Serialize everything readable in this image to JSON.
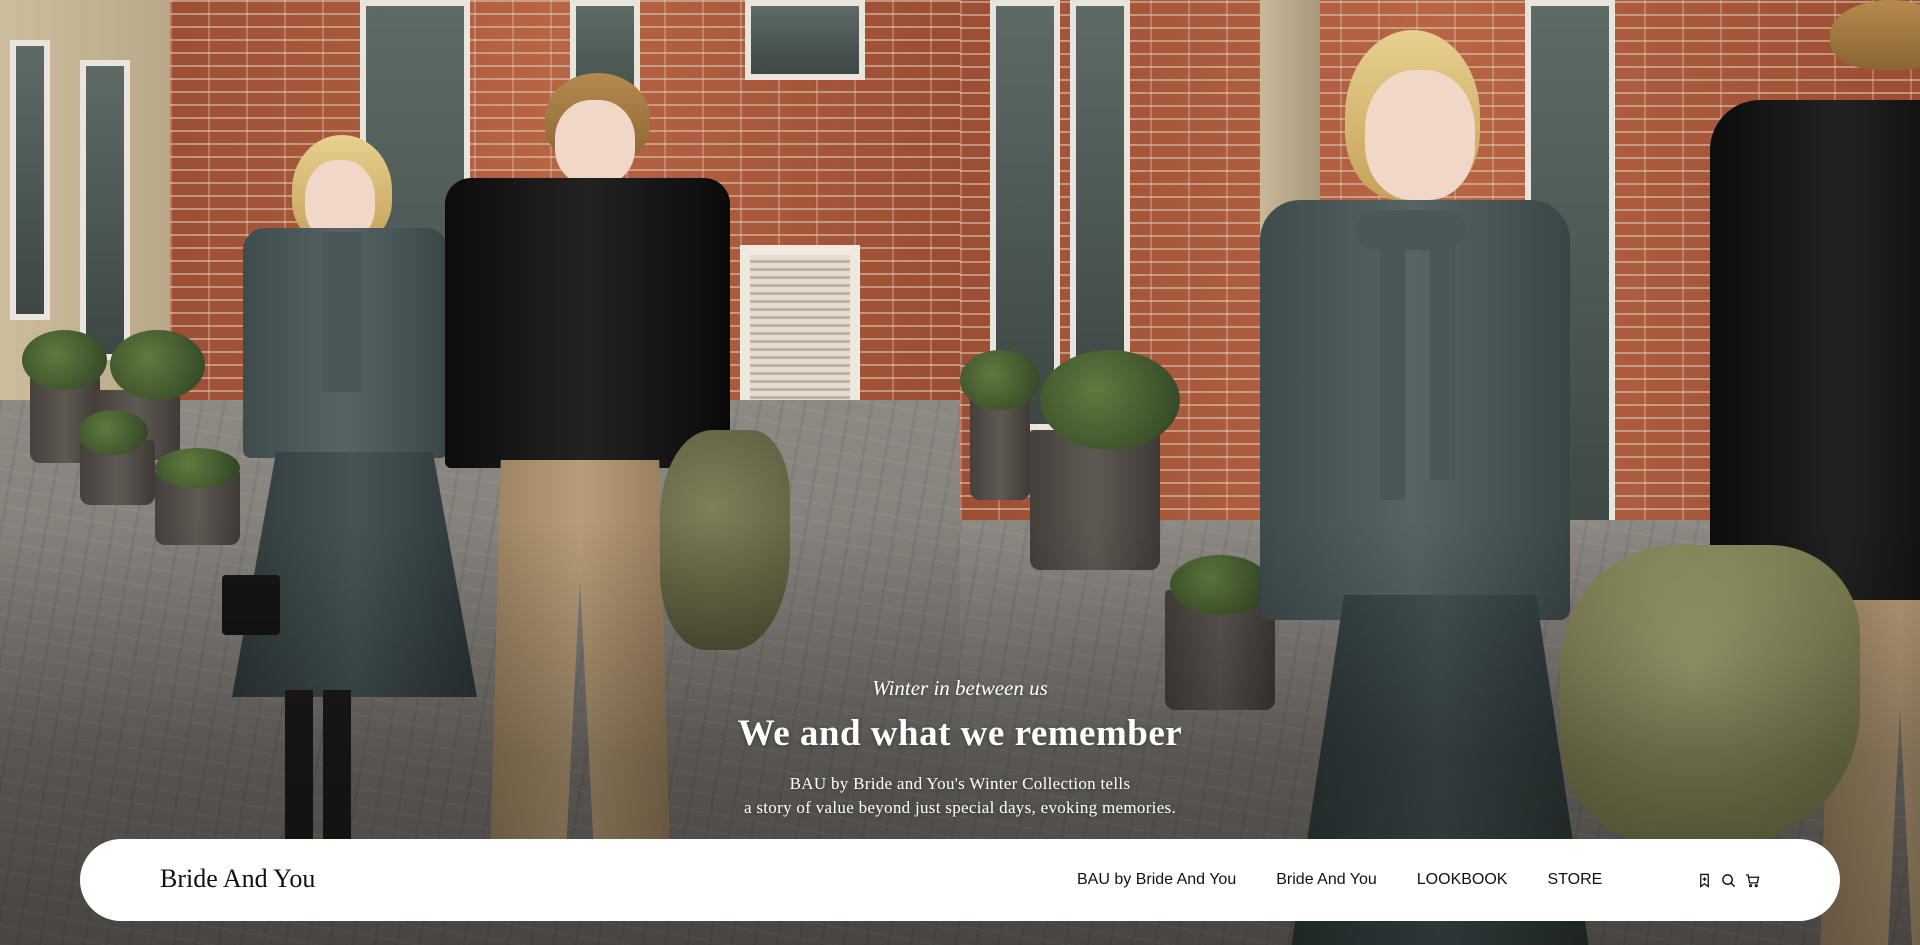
{
  "hero": {
    "eyebrow": "Winter in between us",
    "title": "We and what we remember",
    "description_line1": "BAU by Bride and You's Winter Collection tells",
    "description_line2": "a story of value beyond just special days, evoking memories."
  },
  "nav": {
    "brand": "Bride And You",
    "links": [
      {
        "label": "BAU by Bride And You"
      },
      {
        "label": "Bride And You"
      },
      {
        "label": "LOOKBOOK"
      },
      {
        "label": "STORE"
      }
    ],
    "icons": [
      "bookmark-icon",
      "search-icon",
      "cart-icon"
    ]
  },
  "colors": {
    "navbar_background": "#ffffff",
    "hero_text": "#ffffff",
    "nav_text": "#111111"
  }
}
